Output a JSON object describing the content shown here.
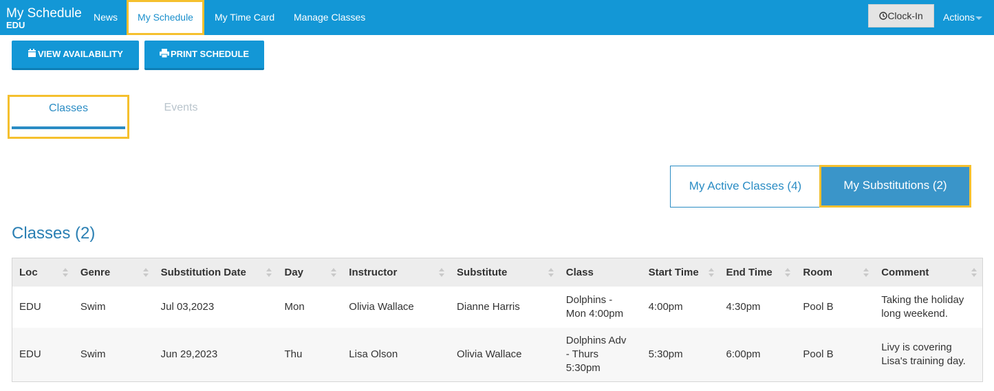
{
  "navbar": {
    "brand_title": "My Schedule",
    "brand_subtitle": "EDU",
    "items": [
      {
        "label": "News"
      },
      {
        "label": "My Schedule"
      },
      {
        "label": "My Time Card"
      },
      {
        "label": "Manage Classes"
      }
    ],
    "clock_in_label": "Clock-In",
    "actions_label": "Actions",
    "accent_color": "#1397d6",
    "highlight_color": "#f5c02e"
  },
  "toolbar": {
    "view_availability_label": "VIEW AVAILABILITY",
    "print_schedule_label": "PRINT SCHEDULE"
  },
  "main_tabs": {
    "classes_label": "Classes",
    "events_label": "Events",
    "selected": "Classes"
  },
  "toggle": {
    "active_classes_label": "My Active Classes (4)",
    "substitutions_label": "My Substitutions (2)",
    "selected": "My Substitutions (2)"
  },
  "section": {
    "heading": "Classes (2)"
  },
  "table": {
    "columns": [
      "Loc",
      "Genre",
      "Substitution Date",
      "Day",
      "Instructor",
      "Substitute",
      "Class",
      "Start Time",
      "End Time",
      "Room",
      "Comment"
    ],
    "rows": [
      {
        "loc": "EDU",
        "genre": "Swim",
        "substitution_date": "Jul 03,2023",
        "day": "Mon",
        "instructor": "Olivia Wallace",
        "substitute": "Dianne Harris",
        "class_line1": "Dolphins -",
        "class_line2": "Mon 4:00pm",
        "class_line3": "",
        "start_time": "4:00pm",
        "end_time": "4:30pm",
        "room": "Pool B",
        "comment_line1": "Taking the holiday",
        "comment_line2": "long weekend."
      },
      {
        "loc": "EDU",
        "genre": "Swim",
        "substitution_date": "Jun 29,2023",
        "day": "Thu",
        "instructor": "Lisa Olson",
        "substitute": "Olivia Wallace",
        "class_line1": "Dolphins Adv",
        "class_line2": "- Thurs",
        "class_line3": "5:30pm",
        "start_time": "5:30pm",
        "end_time": "6:00pm",
        "room": "Pool B",
        "comment_line1": "Livy is covering",
        "comment_line2": "Lisa's training day."
      }
    ]
  }
}
